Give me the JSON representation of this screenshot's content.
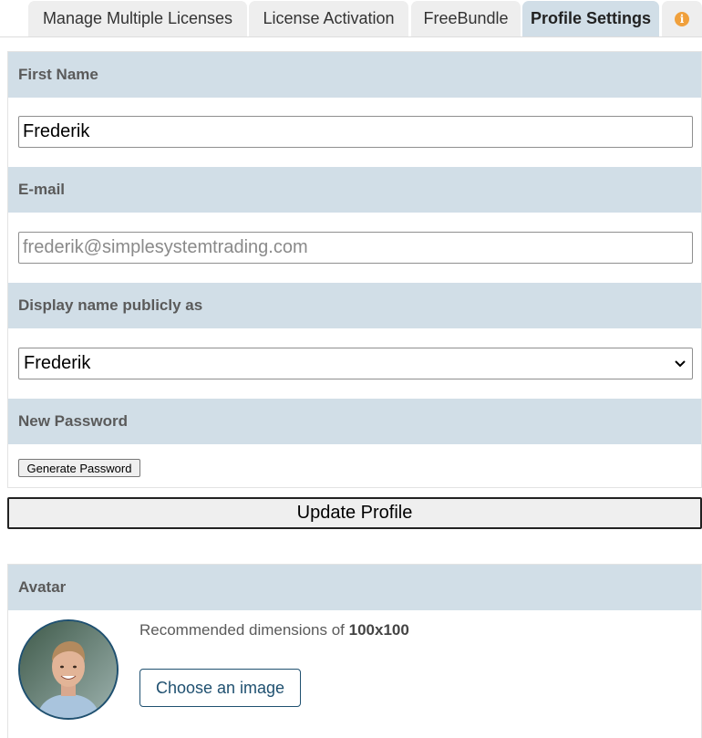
{
  "tabs": [
    {
      "label": "Manage Multiple Licenses",
      "active": false
    },
    {
      "label": "License Activation",
      "active": false
    },
    {
      "label": "FreeBundle",
      "active": false
    },
    {
      "label": "Profile Settings",
      "active": true
    }
  ],
  "info_glyph": "i",
  "form": {
    "first_name_label": "First Name",
    "first_name_value": "Frederik",
    "email_label": "E-mail",
    "email_placeholder": "frederik@simplesystemtrading.com",
    "display_name_label": "Display name publicly as",
    "display_name_selected": "Frederik",
    "password_label": "New Password",
    "generate_password_label": "Generate Password"
  },
  "update_profile_label": "Update Profile",
  "avatar": {
    "label": "Avatar",
    "recommended_prefix": "Recommended dimensions of ",
    "recommended_size": "100x100",
    "choose_label": "Choose an image"
  },
  "colors": {
    "section_header_bg": "#d1dee7",
    "accent": "#1f5070",
    "info_icon": "#f0a03c"
  },
  "icons": {
    "info": "info-icon",
    "select_arrow": "chevron-down-icon"
  }
}
